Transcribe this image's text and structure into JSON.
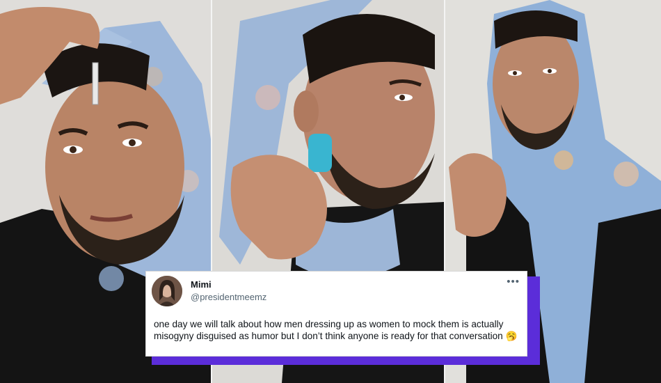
{
  "tweet": {
    "name": "Mimi",
    "handle": "@presidentmeemz",
    "more_icon": "•••",
    "text": "one day we will talk about how men dressing up as women to mock them is actually misogyny disguised as humor but I don’t think anyone is ready for that conversation 🥱"
  },
  "colors": {
    "accent_shadow": "#5b2dd9",
    "card_bg": "#ffffff",
    "scarf_blue": "#8fb0d8",
    "shirt": "#121212"
  }
}
